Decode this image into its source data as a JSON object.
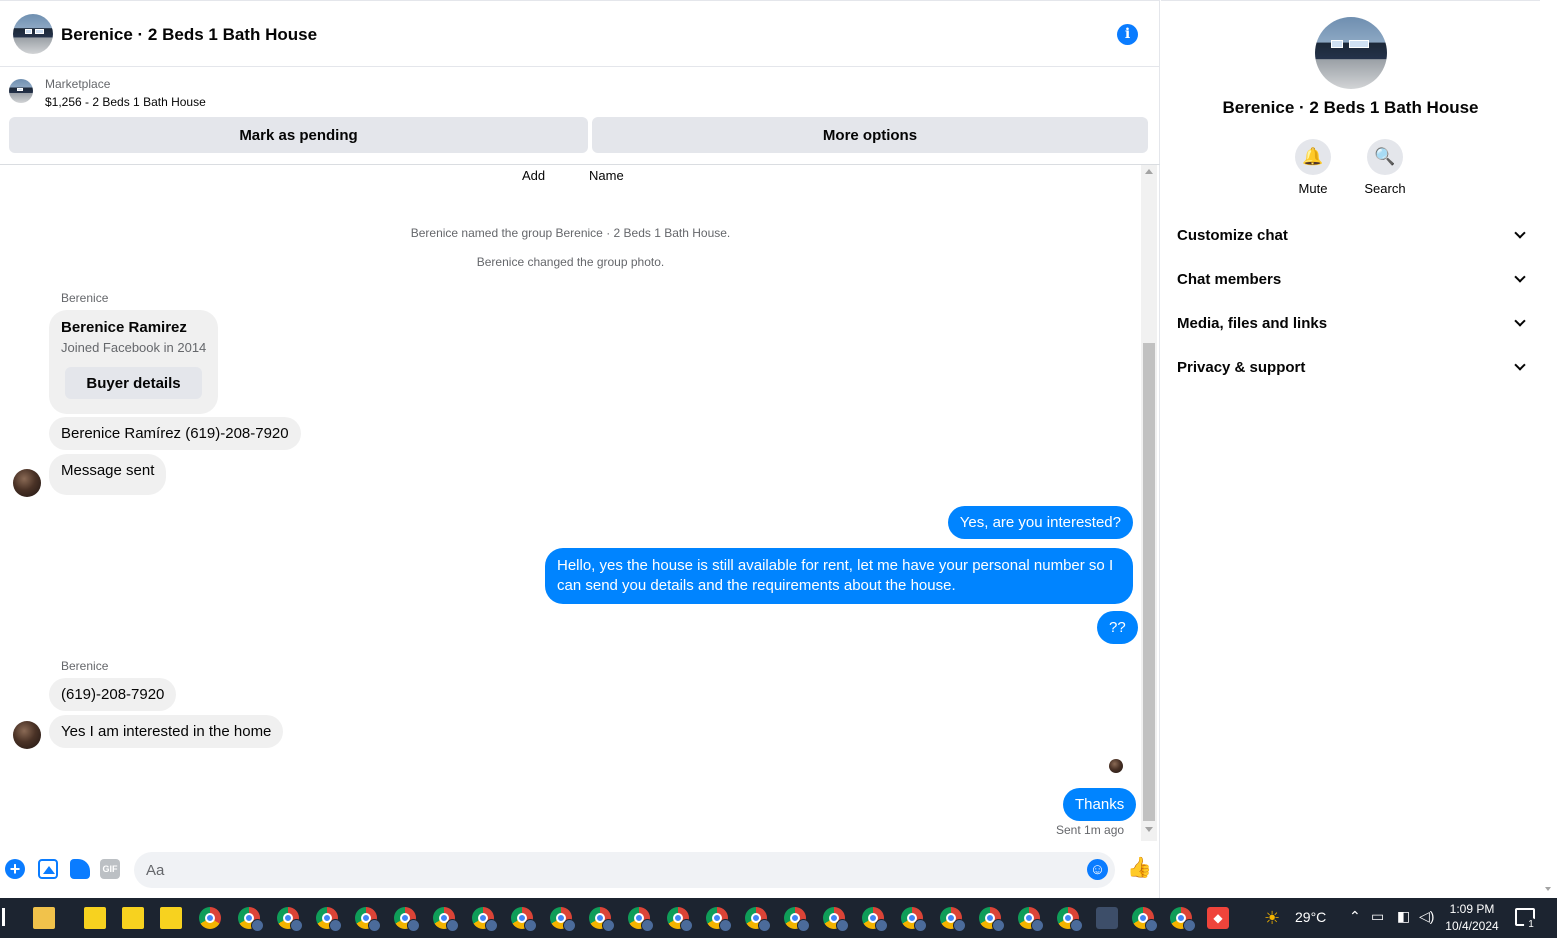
{
  "header": {
    "title": "Berenice · 2 Beds 1 Bath House",
    "info_icon": "info-icon"
  },
  "listing": {
    "source": "Marketplace",
    "summary": "$1,256 - 2 Beds 1 Bath House",
    "buttons": {
      "pending": "Mark as pending",
      "more": "More options"
    }
  },
  "messages": {
    "top_labels": {
      "add": "Add",
      "name": "Name"
    },
    "events": [
      "Berenice named the group Berenice · 2 Beds 1 Bath House.",
      "Berenice changed the group photo."
    ],
    "sender_name": "Berenice",
    "card": {
      "name": "Berenice Ramirez",
      "joined": "Joined Facebook in 2014",
      "button": "Buyer details"
    },
    "incoming_1": [
      "Berenice Ramírez (619)-208-7920",
      "Message sent"
    ],
    "outgoing_1": [
      "Yes, are you interested?",
      "Hello, yes the house is still available for rent, let me have your personal number so I can send you details and the requirements about the house.",
      "??"
    ],
    "incoming_2": [
      "(619)-208-7920",
      "Yes I am interested in the home"
    ],
    "outgoing_2": [
      "Thanks"
    ],
    "status": "Sent 1m ago"
  },
  "composer": {
    "placeholder": "Aa",
    "gif_label": "GIF",
    "icons": [
      "plus-icon",
      "photo-icon",
      "sticker-icon",
      "gif-icon",
      "emoji-icon",
      "thumbs-up-icon"
    ]
  },
  "panel": {
    "title": "Berenice · 2 Beds 1 Bath House",
    "actions": {
      "mute": "Mute",
      "search": "Search"
    },
    "sections": [
      "Customize chat",
      "Chat members",
      "Media, files and links",
      "Privacy & support"
    ]
  },
  "taskbar": {
    "temperature": "29°C",
    "time": "1:09 PM",
    "date": "10/4/2024",
    "notification_count": "1",
    "colors": {
      "background": "#1c2430",
      "accent": "#0084ff"
    }
  }
}
